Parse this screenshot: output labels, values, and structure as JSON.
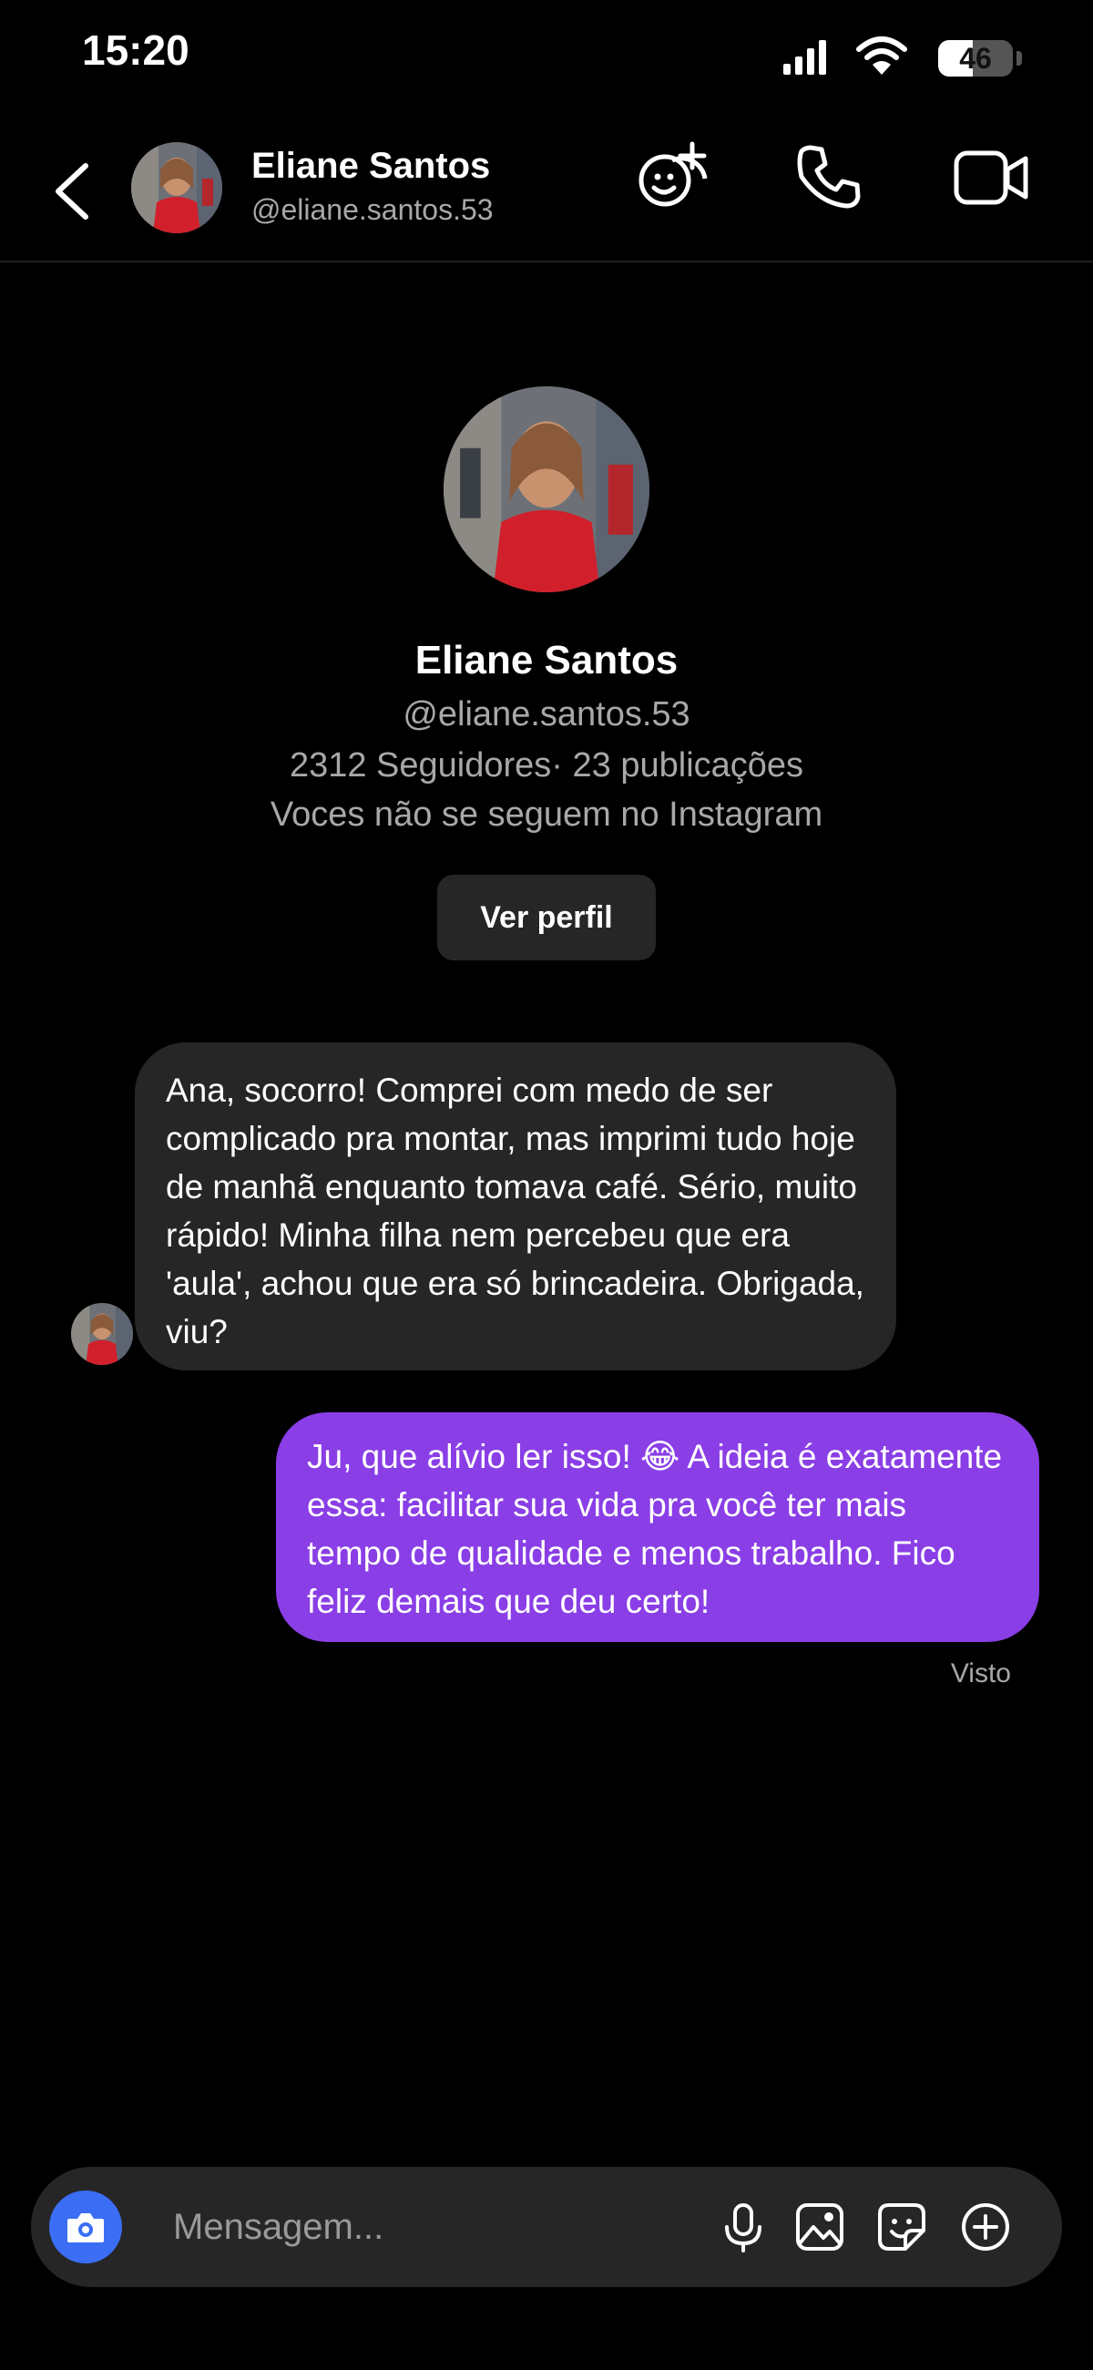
{
  "status_bar": {
    "time": "15:20",
    "battery_text": "46",
    "battery_level": 0.46
  },
  "header": {
    "name": "Eliane Santos",
    "username": "@eliane.santos.53",
    "icons": [
      "back-icon",
      "avatar",
      "effects-icon",
      "phone-icon",
      "video-icon"
    ]
  },
  "profile": {
    "name": "Eliane Santos",
    "username": "@eliane.santos.53",
    "stats": "2312 Seguidores· 23 publicações",
    "follow_note": "Voces não se seguem no Instagram",
    "view_profile_label": "Ver perfil"
  },
  "messages": [
    {
      "direction": "incoming",
      "text": "Ana, socorro! Comprei com medo de ser complicado pra montar, mas imprimi tudo hoje de manhã enquanto tomava café. Sério, muito rápido! Minha filha nem percebeu que era 'aula', achou que era só brincadeira. Obrigada, viu?"
    },
    {
      "direction": "outgoing",
      "text": "Ju, que alívio ler isso! 😂 A ideia é exatamente essa: facilitar sua vida pra você ter mais tempo de qualidade e menos trabalho. Fico feliz demais que deu certo!"
    }
  ],
  "seen_label": "Visto",
  "composer": {
    "placeholder": "Mensagem...",
    "icons": [
      "camera-icon",
      "mic-icon",
      "gallery-icon",
      "sticker-icon",
      "plus-icon"
    ]
  },
  "colors": {
    "background": "#000000",
    "incoming_bubble": "#262626",
    "outgoing_bubble": "#8a3ee6",
    "camera_button": "#3b6ef5",
    "secondary_text": "#a8a8a8"
  }
}
